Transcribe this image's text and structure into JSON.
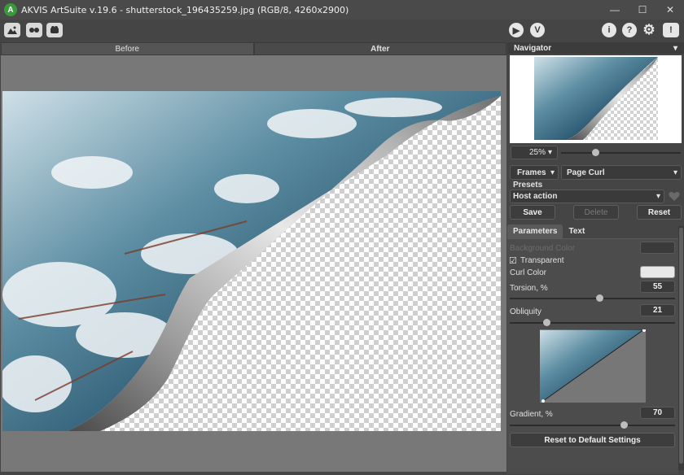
{
  "window": {
    "title": "AKVIS ArtSuite v.19.6 - shutterstock_196435259.jpg (RGB/8, 4260x2900)",
    "logo_letter": "A",
    "minimize": "—",
    "maximize": "☐",
    "close": "✕"
  },
  "toolbar": {
    "open_icon": "open-image-icon",
    "batch_icon": "batch-icon",
    "plugins_icon": "plugins-icon",
    "run_glyph": "▶",
    "apply_glyph": "V",
    "info_glyph": "i",
    "help_glyph": "?",
    "settings_glyph": "⚙",
    "feedback_glyph": "!"
  },
  "view": {
    "before_tab": "Before",
    "after_tab": "After"
  },
  "navigator": {
    "header": "Navigator",
    "header_arrow": "▾",
    "zoom": "25%",
    "zoom_arrow": "▾",
    "zoom_slider_fraction": 0.35
  },
  "effect": {
    "group": "Frames",
    "frame": "Page Curl",
    "arrow": "▾"
  },
  "presets": {
    "label": "Presets",
    "current": "Host action",
    "arrow": "▾",
    "favorite_icon": "heart-icon",
    "save": "Save",
    "delete": "Delete",
    "reset": "Reset"
  },
  "tabs": {
    "parameters": "Parameters",
    "text": "Text"
  },
  "parameters": {
    "background_color_label": "Background Color",
    "transparent_label": "Transparent",
    "transparent_checked": "☑",
    "curl_color_label": "Curl Color",
    "torsion_label": "Torsion, %",
    "torsion_value": "55",
    "torsion_fraction": 0.55,
    "obliquity_label": "Obliquity",
    "obliquity_value": "21",
    "obliquity_fraction": 0.21,
    "gradient_label": "Gradient, %",
    "gradient_value": "70",
    "gradient_fraction": 0.7,
    "reset_default": "Reset to Default Settings"
  },
  "colors": {
    "curl_color": "#e8e8e8",
    "background_color": "#3a3a3a",
    "accent_green": "#3a9a3a"
  }
}
